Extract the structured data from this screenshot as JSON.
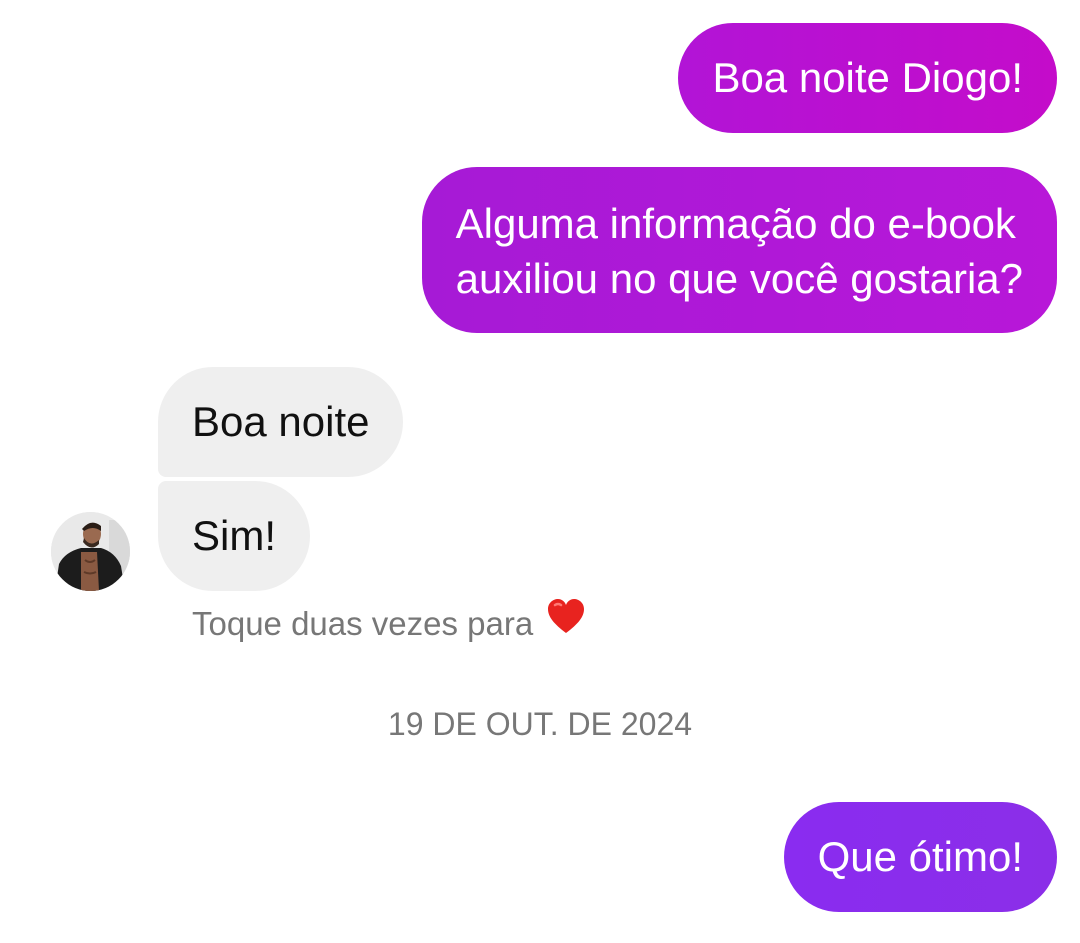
{
  "messages": [
    {
      "direction": "outgoing",
      "text": "Boa noite Diogo!"
    },
    {
      "direction": "outgoing",
      "line1": "Alguma informação do e-book",
      "line2": "auxiliou no que você gostaria?"
    },
    {
      "direction": "incoming",
      "text": "Boa noite"
    },
    {
      "direction": "incoming",
      "text": "Sim!"
    },
    {
      "direction": "outgoing",
      "text": "Que ótimo!"
    }
  ],
  "reaction_hint": {
    "text": "Toque duas vezes para",
    "icon": "heart-icon",
    "icon_color": "#e8231f"
  },
  "date_separator": "19 DE OUT. DE 2024",
  "colors": {
    "outgoing_top": "#c40cca",
    "outgoing_mid": "#b019d9",
    "outgoing_bottom": "#8a2cf0",
    "incoming_bubble": "#efefef",
    "meta_text": "#777777"
  },
  "contact": {
    "avatar": "contact-avatar"
  }
}
